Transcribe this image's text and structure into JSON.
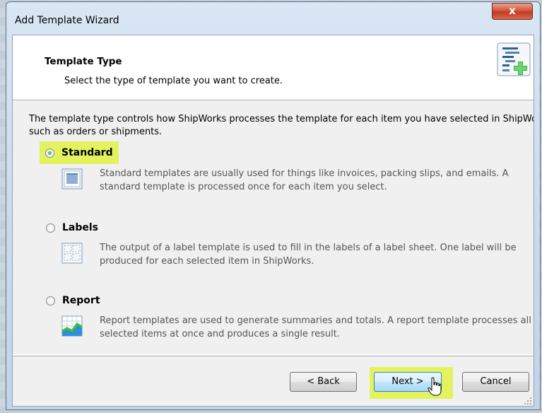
{
  "window": {
    "title": "Add Template Wizard",
    "close_label": "x"
  },
  "header": {
    "title": "Template Type",
    "subtitle": "Select the type of template you want to create.",
    "icon": "template-add-icon"
  },
  "body": {
    "description": "The template type controls how ShipWorks processes the template for each item you have selected in ShipWorks, such as orders or shipments.",
    "options": [
      {
        "label": "Standard",
        "selected": true,
        "icon": "standard-template-icon",
        "description": "Standard templates are usually used for things like invoices, packing slips, and emails. A standard template is processed once for each item you select."
      },
      {
        "label": "Labels",
        "selected": false,
        "icon": "labels-template-icon",
        "description": "The output of a label template is used to fill in the labels of a label sheet. One label will be produced for each selected item in ShipWorks."
      },
      {
        "label": "Report",
        "selected": false,
        "icon": "report-template-icon",
        "description": "Report templates are used to generate summaries and totals.  A report template processes all selected items at once and produces a single result."
      }
    ]
  },
  "footer": {
    "back_label": "< Back",
    "next_label": "Next >",
    "cancel_label": "Cancel"
  },
  "colors": {
    "highlight": "#e3f25f",
    "close_red": "#c23b22",
    "next_blue": "#bee6fd"
  }
}
